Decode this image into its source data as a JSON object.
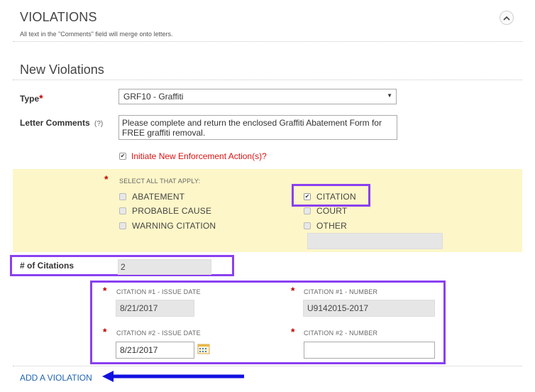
{
  "section": {
    "title": "VIOLATIONS",
    "note": "All text in the \"Comments\" field will merge onto letters.",
    "collapse_icon": "chevron-up-icon"
  },
  "new_violations": {
    "heading": "New Violations",
    "type_label": "Type",
    "type_value": "GRF10 - Graffiti",
    "letter_comments_label": "Letter Comments",
    "letter_comments_help": "(?)",
    "letter_comments_value": "Please complete and return the enclosed Graffiti Abatement Form for FREE graffiti removal.",
    "initiate_label": "Initiate New Enforcement Action(s)?",
    "initiate_checked": true
  },
  "enforcement": {
    "select_all_label": "SELECT ALL THAT APPLY:",
    "options": [
      {
        "label": "ABATEMENT",
        "checked": false
      },
      {
        "label": "PROBABLE CAUSE",
        "checked": false
      },
      {
        "label": "WARNING CITATION",
        "checked": false
      },
      {
        "label": "CITATION",
        "checked": true
      },
      {
        "label": "COURT",
        "checked": false
      },
      {
        "label": "OTHER",
        "checked": false
      }
    ],
    "other_value": ""
  },
  "citations": {
    "count_label": "# of Citations",
    "count_value": "2",
    "items": [
      {
        "date_label": "CITATION #1 - ISSUE DATE",
        "date_value": "8/21/2017",
        "number_label": "CITATION #1 - NUMBER",
        "number_value": "U9142015-2017"
      },
      {
        "date_label": "CITATION #2 - ISSUE DATE",
        "date_value": "8/21/2017",
        "number_label": "CITATION #2 - NUMBER",
        "number_value": ""
      }
    ]
  },
  "footer": {
    "add_violation_label": "ADD A VIOLATION"
  },
  "colors": {
    "highlight_border": "#8a3ff0",
    "arrow": "#1010e0",
    "yellow_panel": "#fdf6c8",
    "link": "#1f64b0",
    "required": "#c00000"
  }
}
